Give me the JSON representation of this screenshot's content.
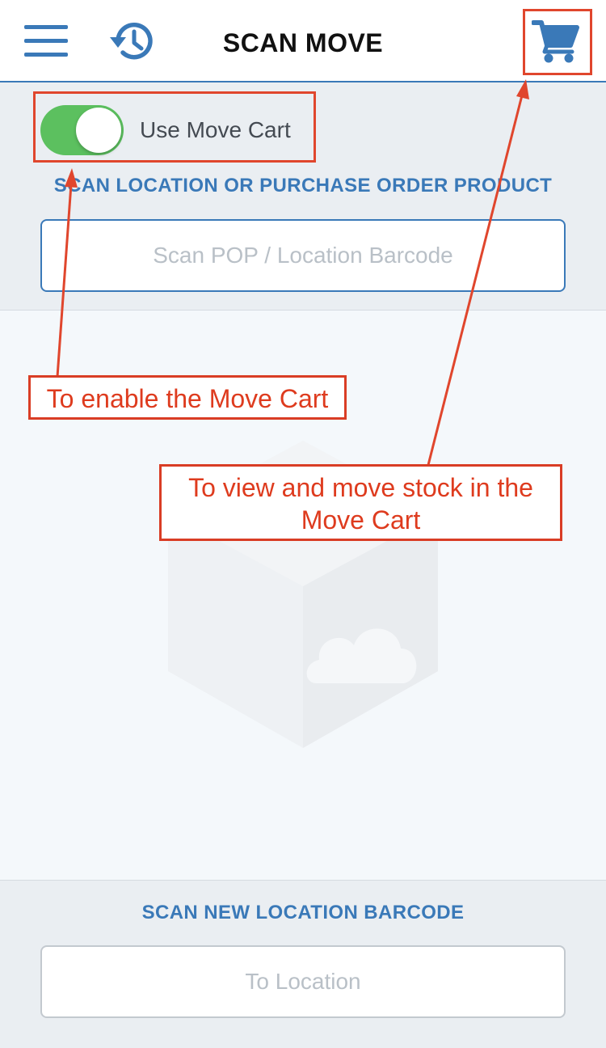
{
  "header": {
    "title": "SCAN MOVE",
    "menu_icon": "hamburger-menu-icon",
    "history_icon": "history-icon",
    "cart_icon": "shopping-cart-icon"
  },
  "scan": {
    "toggle_label": "Use Move Cart",
    "toggle_on": true,
    "section_label": "SCAN LOCATION OR PURCHASE ORDER PRODUCT",
    "input_placeholder": "Scan POP / Location Barcode",
    "input_value": ""
  },
  "destination": {
    "section_label": "SCAN NEW LOCATION BARCODE",
    "input_placeholder": "To Location",
    "input_value": ""
  },
  "annotations": {
    "toggle_note": "To enable the Move Cart",
    "cart_note_line1": "To view and move stock in the",
    "cart_note_line2": "Move Cart"
  },
  "colors": {
    "accent": "#3a79b8",
    "toggle_on": "#5cc05f",
    "annotation": "#e0462d",
    "panel_bg": "#eaeef2",
    "content_bg": "#f4f8fb"
  }
}
